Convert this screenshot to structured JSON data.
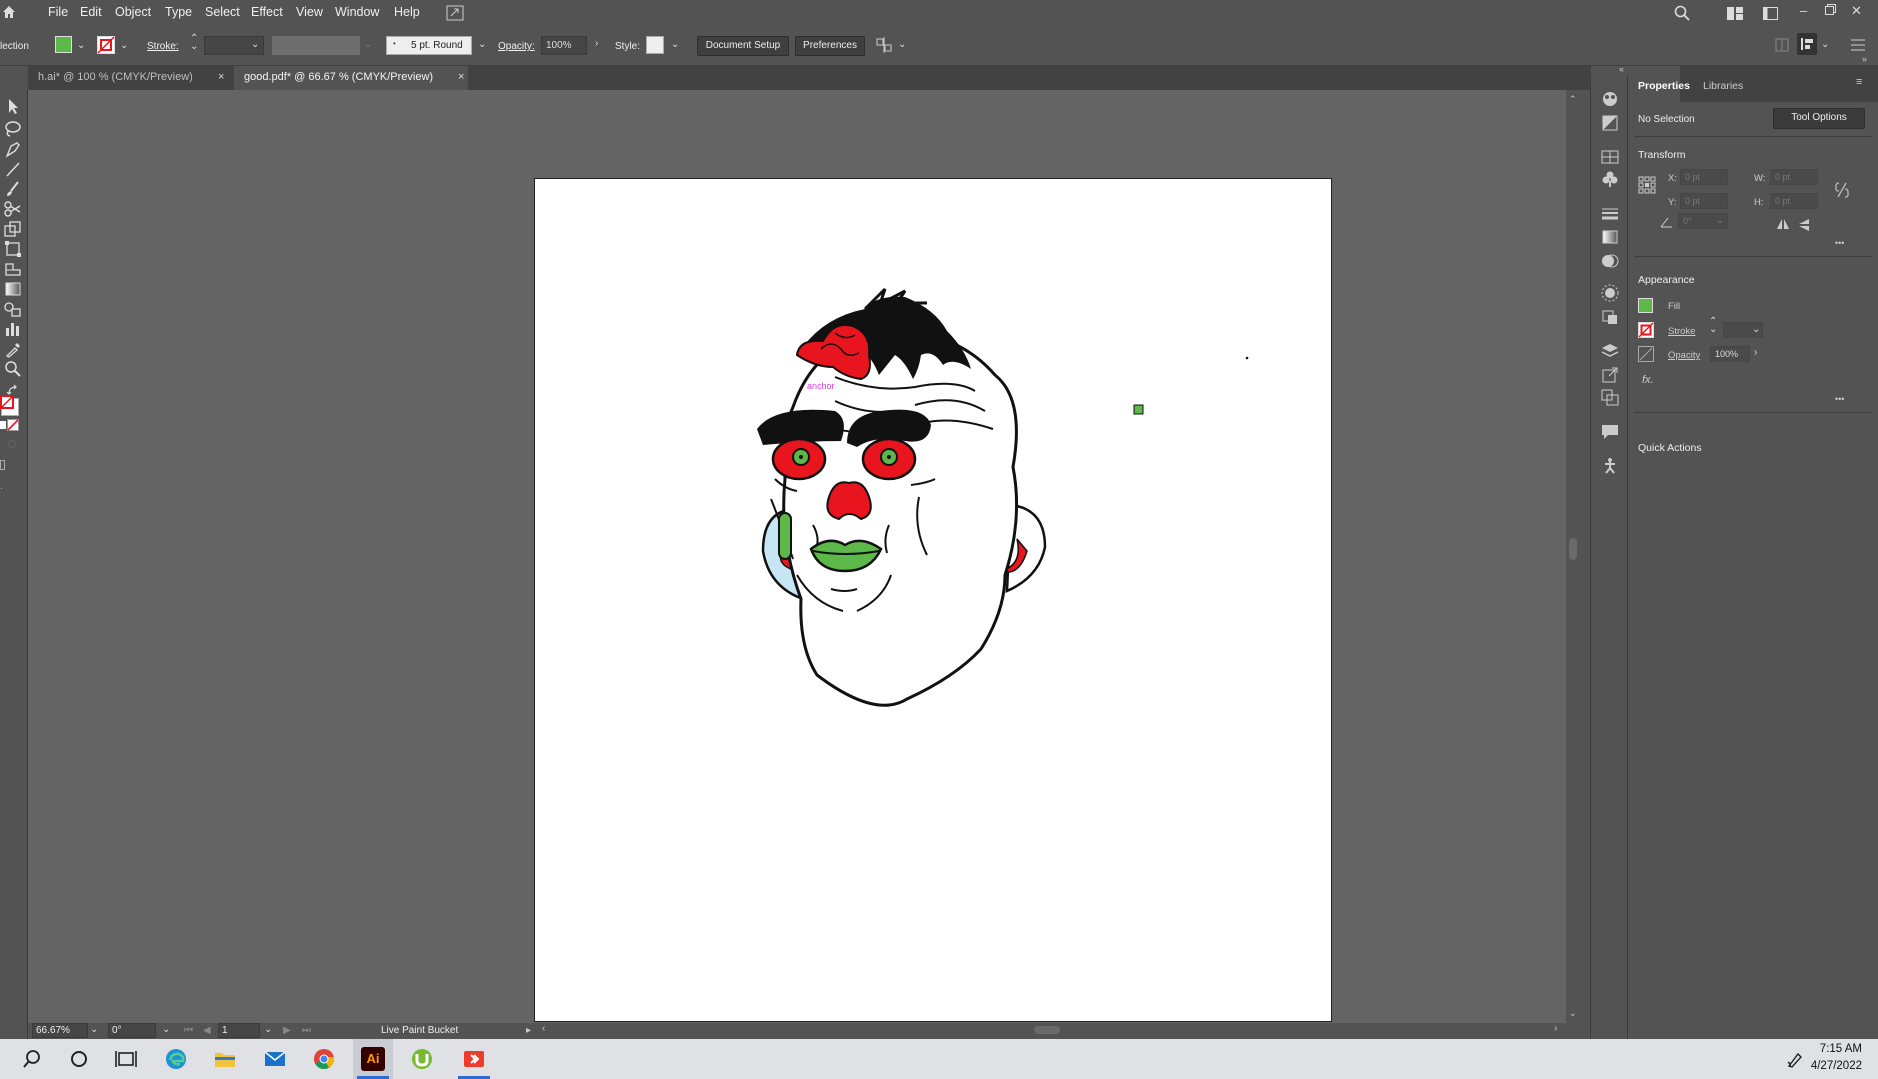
{
  "menu": {
    "items": [
      "File",
      "Edit",
      "Object",
      "Type",
      "Select",
      "Effect",
      "View",
      "Window",
      "Help"
    ]
  },
  "control_bar": {
    "selection_label": "lection",
    "stroke_label": "Stroke:",
    "brush_value": "5 pt. Round",
    "opacity_label": "Opacity:",
    "opacity_value": "100%",
    "style_label": "Style:",
    "document_setup": "Document Setup",
    "preferences": "Preferences",
    "fill_color": "#5cb848",
    "stroke_color": "#e8141e"
  },
  "tabs": [
    {
      "label": "h.ai* @ 100 % (CMYK/Preview)",
      "active": false
    },
    {
      "label": "good.pdf* @ 66.67 % (CMYK/Preview)",
      "active": true
    }
  ],
  "tab_close_glyph": "×",
  "canvas": {
    "anchor_hint": "anchor"
  },
  "status_bar": {
    "zoom": "66.67%",
    "rotation": "0°",
    "artboard_number": "1",
    "current_tool": "Live Paint Bucket"
  },
  "panel": {
    "tabs": [
      "Properties",
      "Libraries"
    ],
    "selection_state": "No Selection",
    "tool_options_button": "Tool Options",
    "transform": {
      "title": "Transform",
      "x_label": "X:",
      "x_value": "0 pt",
      "y_label": "Y:",
      "y_value": "0 pt",
      "w_label": "W:",
      "w_value": "0 pt",
      "h_label": "H:",
      "h_value": "0 pt",
      "angle_value": "0°"
    },
    "appearance": {
      "title": "Appearance",
      "fill_label": "Fill",
      "stroke_label": "Stroke",
      "opacity_label": "Opacity",
      "opacity_value": "100%",
      "fx_label": "fx."
    },
    "quick_actions": "Quick Actions",
    "more_glyph": "•••"
  },
  "taskbar": {
    "time": "7:15 AM",
    "date": "4/27/2022",
    "illustrator_label": "Ai"
  }
}
